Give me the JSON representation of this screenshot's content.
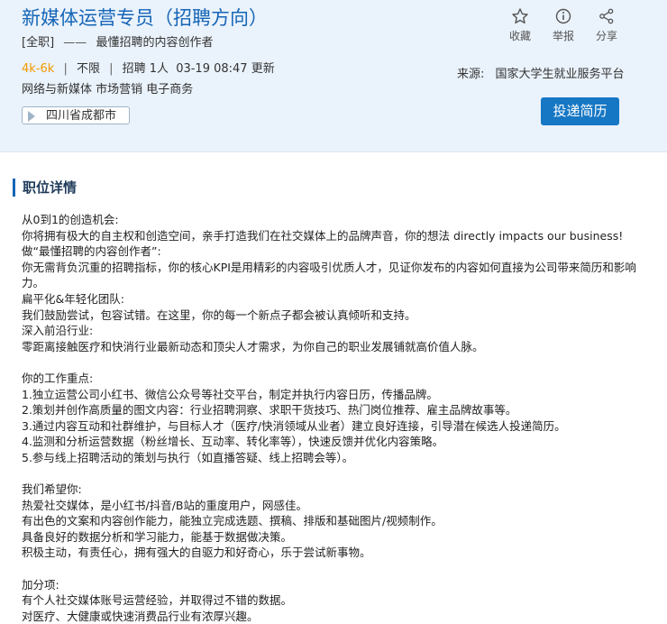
{
  "job": {
    "title": "新媒体运营专员（招聘方向）",
    "type_tag": "[全职]",
    "dash": "——",
    "tagline": "最懂招聘的内容创作者",
    "salary": "4k-6k",
    "sep": "|",
    "education": "不限",
    "headcount": "招聘 1人",
    "updated": "03-19 08:47 更新",
    "categories": "网络与新媒体 市场营销 电子商务",
    "location": "四川省成都市",
    "source_label": "来源:",
    "source_value": "国家大学生就业服务平台",
    "apply_label": "投递简历"
  },
  "actions": {
    "favorite": "收藏",
    "report": "举报",
    "share": "分享"
  },
  "section": {
    "title": "职位详情"
  },
  "description": [
    "从0到1的创造机会:",
    "你将拥有极大的自主权和创造空间，亲手打造我们在社交媒体上的品牌声音，你的想法 directly impacts our business!",
    "做“最懂招聘的内容创作者”:",
    "你无需背负沉重的招聘指标，你的核心KPI是用精彩的内容吸引优质人才，见证你发布的内容如何直接为公司带来简历和影响力。",
    "扁平化&年轻化团队:",
    "我们鼓励尝试，包容试错。在这里，你的每一个新点子都会被认真倾听和支持。",
    "深入前沿行业:",
    "零距离接触医疗和快消行业最新动态和顶尖人才需求，为你自己的职业发展铺就高价值人脉。",
    "",
    "你的工作重点:",
    "1.独立运营公司小红书、微信公众号等社交平台，制定并执行内容日历，传播品牌。",
    "2.策划并创作高质量的图文内容：行业招聘洞察、求职干货技巧、热门岗位推荐、雇主品牌故事等。",
    "3.通过内容互动和社群维护，与目标人才（医疗/快消领域从业者）建立良好连接，引导潜在候选人投递简历。",
    "4.监测和分析运营数据（粉丝增长、互动率、转化率等），快速反馈并优化内容策略。",
    "5.参与线上招聘活动的策划与执行（如直播答疑、线上招聘会等）。",
    "",
    "我们希望你:",
    "热爱社交媒体，是小红书/抖音/B站的重度用户，网感佳。",
    "有出色的文案和内容创作能力，能独立完成选题、撰稿、排版和基础图片/视频制作。",
    "具备良好的数据分析和学习能力，能基于数据做决策。",
    "积极主动，有责任心，拥有强大的自驱力和好奇心，乐于尝试新事物。",
    "",
    "加分项:",
    "有个人社交媒体账号运营经验，并取得过不错的数据。",
    "对医疗、大健康或快速消费品行业有浓厚兴趣。"
  ],
  "colors": {
    "accent": "#1566b7",
    "button": "#1677c4",
    "salary": "#f39800",
    "header_bg": "#eaf2fb"
  },
  "icons": {
    "favorite": "star-icon",
    "report": "info-icon",
    "share": "share-icon",
    "location": "location-tag-icon"
  }
}
